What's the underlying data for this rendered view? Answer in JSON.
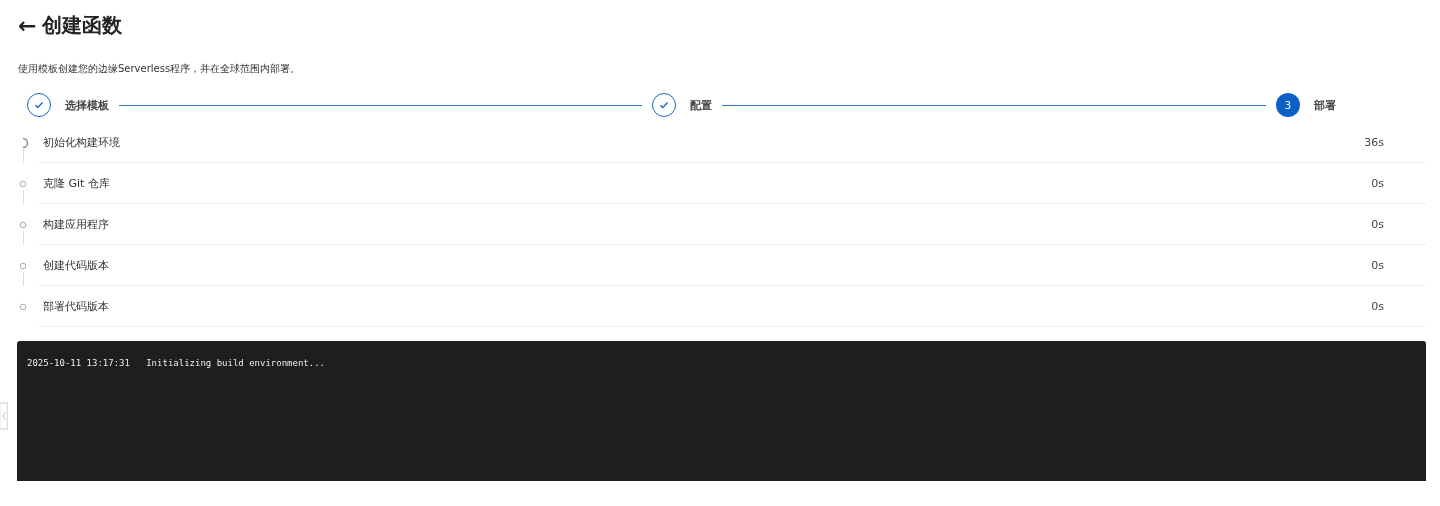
{
  "header": {
    "back": "←",
    "title": "创建函数"
  },
  "description": "使用模板创建您的边缘Serverless程序，并在全球范围内部署。",
  "steps": [
    {
      "label": "选择模板",
      "completed": true
    },
    {
      "label": "配置",
      "completed": true
    },
    {
      "label": "部署",
      "completed": false,
      "number": "3"
    }
  ],
  "tasks": [
    {
      "name": "初始化构建环境",
      "duration": "36s",
      "running": true
    },
    {
      "name": "克隆 Git 仓库",
      "duration": "0s",
      "running": false
    },
    {
      "name": "构建应用程序",
      "duration": "0s",
      "running": false
    },
    {
      "name": "创建代码版本",
      "duration": "0s",
      "running": false
    },
    {
      "name": "部署代码版本",
      "duration": "0s",
      "running": false
    }
  ],
  "log": {
    "lines": [
      {
        "time": "2025-10-11 13:17:31",
        "message": "Initializing build environment..."
      }
    ]
  }
}
